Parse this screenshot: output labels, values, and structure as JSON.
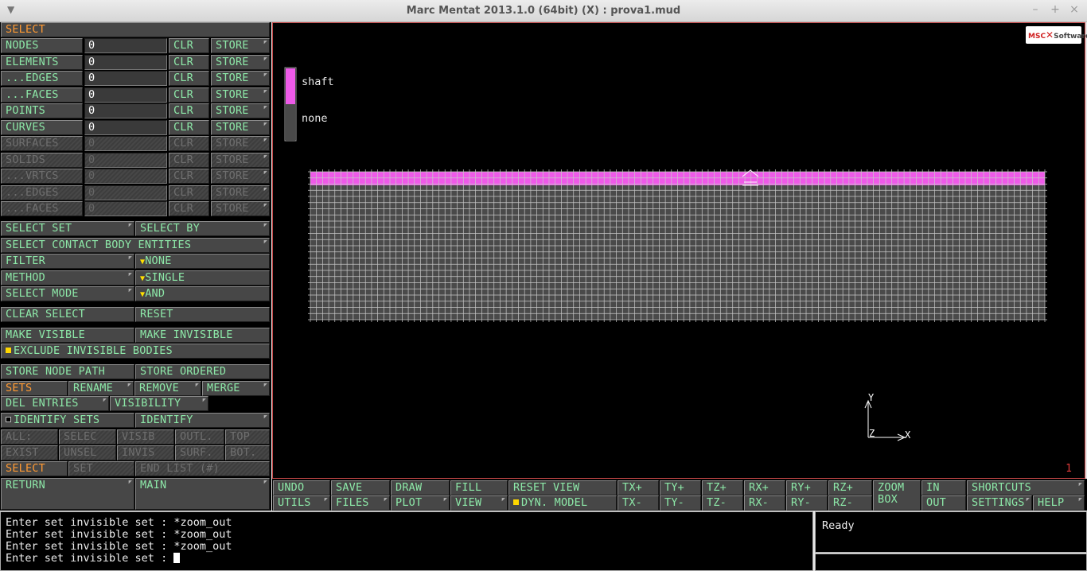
{
  "window": {
    "title": "Marc Mentat 2013.1.0 (64bit) (X) : prova1.mud",
    "menu_glyph": "▼",
    "min_glyph": "–",
    "max_glyph": "+",
    "close_glyph": "×"
  },
  "left": {
    "header": "SELECT",
    "entity_rows": [
      {
        "label": "NODES",
        "value": "0",
        "clr": "CLR",
        "store": "STORE"
      },
      {
        "label": "ELEMENTS",
        "value": "0",
        "clr": "CLR",
        "store": "STORE"
      },
      {
        "label": "...EDGES",
        "value": "0",
        "clr": "CLR",
        "store": "STORE"
      },
      {
        "label": "...FACES",
        "value": "0",
        "clr": "CLR",
        "store": "STORE"
      },
      {
        "label": "POINTS",
        "value": "0",
        "clr": "CLR",
        "store": "STORE"
      },
      {
        "label": "CURVES",
        "value": "0",
        "clr": "CLR",
        "store": "STORE"
      },
      {
        "label": "SURFACES",
        "value": "0",
        "clr": "CLR",
        "store": "STORE"
      },
      {
        "label": "SOLIDS",
        "value": "0",
        "clr": "CLR",
        "store": "STORE"
      },
      {
        "label": "...VRTCS",
        "value": "0",
        "clr": "CLR",
        "store": "STORE"
      },
      {
        "label": "...EDGES",
        "value": "0",
        "clr": "CLR",
        "store": "STORE"
      },
      {
        "label": "...FACES",
        "value": "0",
        "clr": "CLR",
        "store": "STORE"
      }
    ],
    "select_set": "SELECT SET",
    "select_by": "SELECT BY",
    "select_contact": "SELECT CONTACT BODY ENTITIES",
    "filter": "FILTER",
    "filter_value": "NONE",
    "method": "METHOD",
    "method_value": "SINGLE",
    "select_mode": "SELECT MODE",
    "select_mode_value": "AND",
    "clear_select": "CLEAR SELECT",
    "reset": "RESET",
    "make_visible": "MAKE VISIBLE",
    "make_invisible": "MAKE INVISIBLE",
    "exclude_invisible": "EXCLUDE INVISIBLE BODIES",
    "store_node_path": "STORE NODE PATH",
    "store_ordered": "STORE ORDERED",
    "sets": "SETS",
    "rename": "RENAME",
    "remove": "REMOVE",
    "merge": "MERGE",
    "del_entries": "DEL ENTRIES",
    "visibility": "VISIBILITY",
    "identify_sets": "IDENTIFY SETS",
    "identify": "IDENTIFY",
    "row_all": [
      "ALL:",
      "SELEC",
      "VISIB",
      "OUTL.",
      "TOP"
    ],
    "row_exist": [
      "EXIST",
      "UNSEL",
      "INVIS",
      "SURF.",
      "BOT."
    ],
    "select": "SELECT",
    "set": "SET",
    "end_list": "END LIST (#)",
    "return": "RETURN",
    "main": "MAIN"
  },
  "viewport": {
    "legend": [
      {
        "name": "shaft",
        "color": "#ee5ae8"
      },
      {
        "name": "none",
        "color": "#4a4a4a"
      }
    ],
    "axis_x": "X",
    "axis_y": "Y",
    "axis_z": "Z",
    "index": "1",
    "logo_left": "MSC",
    "logo_right": "Software"
  },
  "toolbar": {
    "undo": "UNDO",
    "save": "SAVE",
    "draw": "DRAW",
    "fill": "FILL",
    "reset_view": "RESET VIEW",
    "utils": "UTILS",
    "files": "FILES",
    "plot": "PLOT",
    "view": "VIEW",
    "dyn_model": "DYN. MODEL",
    "tx_plus": "TX+",
    "ty_plus": "TY+",
    "tz_plus": "TZ+",
    "rx_plus": "RX+",
    "ry_plus": "RY+",
    "rz_plus": "RZ+",
    "tx_minus": "TX-",
    "ty_minus": "TY-",
    "tz_minus": "TZ-",
    "rx_minus": "RX-",
    "ry_minus": "RY-",
    "rz_minus": "RZ-",
    "zoom": "ZOOM",
    "box": "BOX",
    "in": "IN",
    "out": "OUT",
    "shortcuts": "SHORTCUTS",
    "settings": "SETTINGS",
    "help": "HELP"
  },
  "console": {
    "lines": [
      "Enter set invisible set : *zoom_out",
      "Enter set invisible set : *zoom_out",
      "Enter set invisible set : *zoom_out",
      "Enter set invisible set : "
    ]
  },
  "status": {
    "text": "Ready"
  },
  "colors": {
    "label_green": "#8de8a8",
    "label_orange": "#ff9a33",
    "mesh_pink": "#ee5ae8",
    "mesh_gray": "#4a4a4a",
    "viewport_border": "#c84848"
  }
}
